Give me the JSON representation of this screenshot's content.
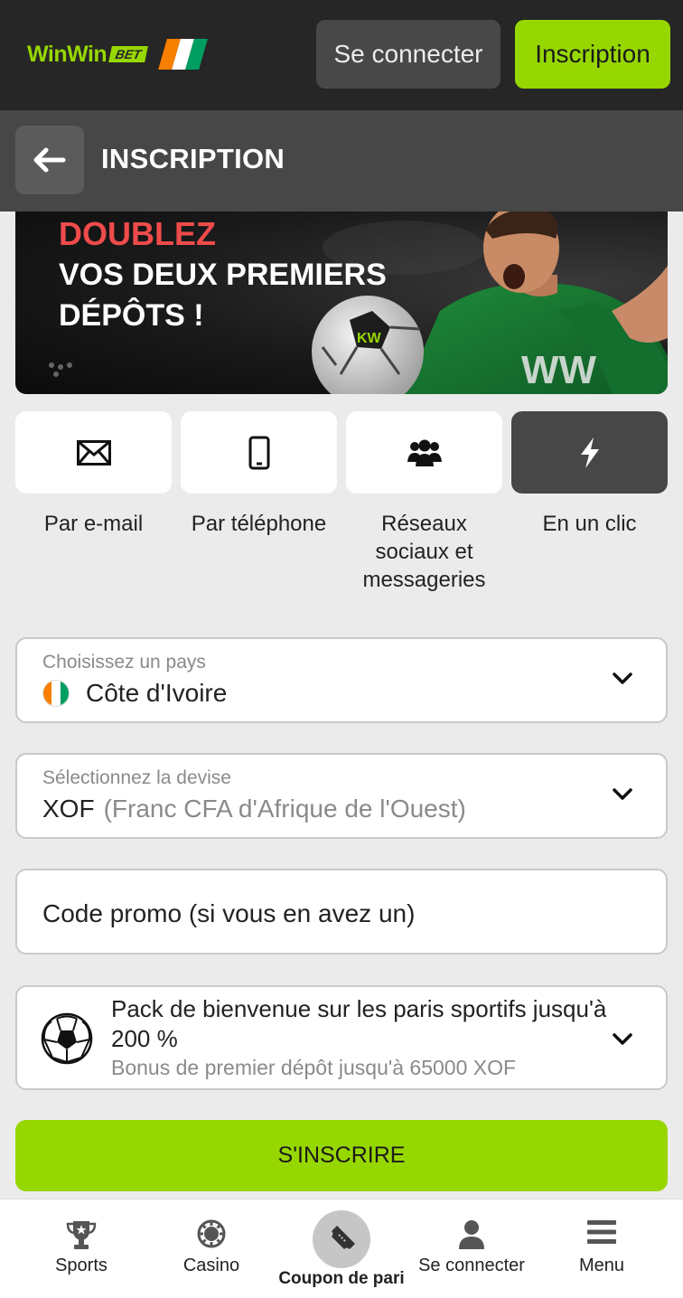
{
  "header": {
    "logo_text": "WinWin",
    "logo_badge": "BET",
    "login_label": "Se connecter",
    "signup_label": "Inscription",
    "flag_colors": [
      "#f77f00",
      "#ffffff",
      "#009e60"
    ]
  },
  "titlebar": {
    "back_icon": "arrow-left-icon",
    "title": "INSCRIPTION"
  },
  "banner": {
    "highlight": "DOUBLEZ",
    "line1": "VOS DEUX PREMIERS",
    "line2": "DÉPÔTS !"
  },
  "methods": [
    {
      "icon": "envelope-icon",
      "label": "Par e-mail",
      "active": false
    },
    {
      "icon": "smartphone-icon",
      "label": "Par téléphone",
      "active": false
    },
    {
      "icon": "users-icon",
      "label": "Réseaux sociaux et messageries",
      "active": false
    },
    {
      "icon": "lightning-icon",
      "label": "En un clic",
      "active": true
    }
  ],
  "country": {
    "label": "Choisissez un pays",
    "value": "Côte d'Ivoire"
  },
  "currency": {
    "label": "Sélectionnez la devise",
    "code": "XOF",
    "name": "(Franc CFA d'Afrique de l'Ouest)"
  },
  "promo": {
    "placeholder": "Code promo (si vous en avez un)"
  },
  "bonus": {
    "title": "Pack de bienvenue sur les paris sportifs jusqu'à 200 %",
    "subtitle": "Bonus de premier dépôt jusqu'à 65000 XOF"
  },
  "submit_label": "S'INSCRIRE",
  "colors": {
    "accent": "#97d700",
    "header_bg": "#262626",
    "titlebar_bg": "#474747",
    "banner_red": "#ef4b4b"
  },
  "bottom_nav": [
    {
      "icon": "trophy-icon",
      "label": "Sports"
    },
    {
      "icon": "casino-chip-icon",
      "label": "Casino"
    },
    {
      "icon": "ticket-icon",
      "label": "Coupon de pari"
    },
    {
      "icon": "user-icon",
      "label": "Se connecter"
    },
    {
      "icon": "hamburger-menu-icon",
      "label": "Menu"
    }
  ]
}
